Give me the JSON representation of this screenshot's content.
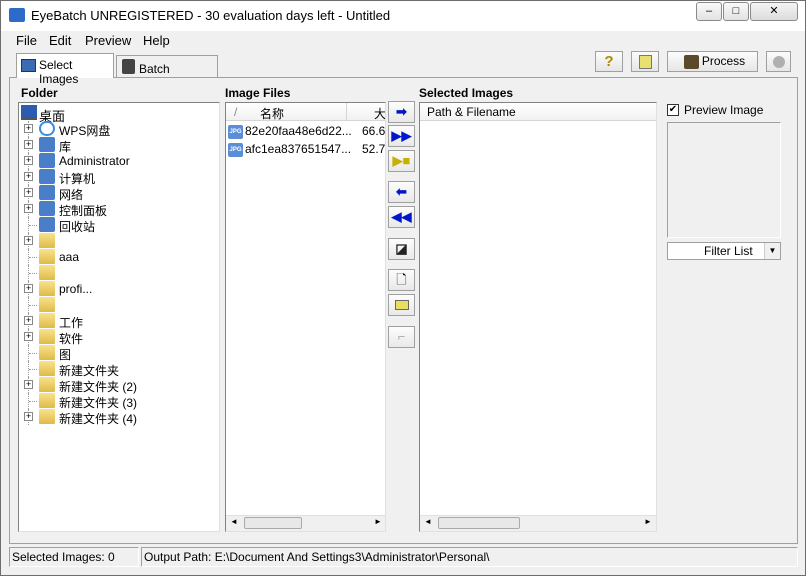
{
  "window": {
    "title": "EyeBatch UNREGISTERED - 30 evaluation days left - Untitled"
  },
  "menu": [
    "File",
    "Edit",
    "Preview",
    "Help"
  ],
  "tabs": [
    {
      "label": "Select Images"
    },
    {
      "label": "Batch Settings"
    }
  ],
  "toolbar": {
    "help": "?",
    "process": "Process"
  },
  "folder": {
    "label": "Folder",
    "root": "桌面",
    "items": [
      {
        "label": "WPS网盘",
        "expand": true,
        "icon": "cloud-icon"
      },
      {
        "label": "库",
        "expand": true,
        "icon": "library-icon"
      },
      {
        "label": "Administrator",
        "expand": true,
        "icon": "user-folder-icon"
      },
      {
        "label": "计算机",
        "expand": true,
        "icon": "computer-icon"
      },
      {
        "label": "网络",
        "expand": true,
        "icon": "network-icon"
      },
      {
        "label": "控制面板",
        "expand": true,
        "icon": "control-panel-icon"
      },
      {
        "label": "回收站",
        "expand": false,
        "icon": "recycle-bin-icon"
      },
      {
        "label": "",
        "expand": true,
        "icon": "folder-icon"
      },
      {
        "label": "aaa",
        "expand": false,
        "icon": "folder-icon"
      },
      {
        "label": "",
        "expand": false,
        "icon": "folder-icon"
      },
      {
        "label": "profi...",
        "expand": true,
        "icon": "folder-icon"
      },
      {
        "label": "",
        "expand": false,
        "icon": "folder-icon"
      },
      {
        "label": "工作",
        "expand": true,
        "icon": "folder-icon"
      },
      {
        "label": "软件",
        "expand": true,
        "icon": "folder-icon"
      },
      {
        "label": "图",
        "expand": false,
        "icon": "folder-icon"
      },
      {
        "label": "新建文件夹",
        "expand": false,
        "icon": "folder-icon"
      },
      {
        "label": "新建文件夹 (2)",
        "expand": true,
        "icon": "folder-icon"
      },
      {
        "label": "新建文件夹 (3)",
        "expand": false,
        "icon": "folder-icon"
      },
      {
        "label": "新建文件夹 (4)",
        "expand": true,
        "icon": "folder-icon"
      }
    ]
  },
  "image_files": {
    "label": "Image Files",
    "columns": [
      "/",
      "名称",
      "大"
    ],
    "rows": [
      {
        "name": "82e20faa48e6d22...",
        "size": "66.6"
      },
      {
        "name": "afc1ea837651547...",
        "size": "52.7"
      }
    ],
    "file_icon_text": "JPG"
  },
  "selected": {
    "label": "Selected Images",
    "column": "Path & Filename"
  },
  "preview": {
    "checkbox_label": "Preview Image",
    "checked": true,
    "filter": "Filter List"
  },
  "status": {
    "selected": "Selected Images: 0",
    "output": "Output Path: E:\\Document And Settings3\\Administrator\\Personal\\"
  }
}
